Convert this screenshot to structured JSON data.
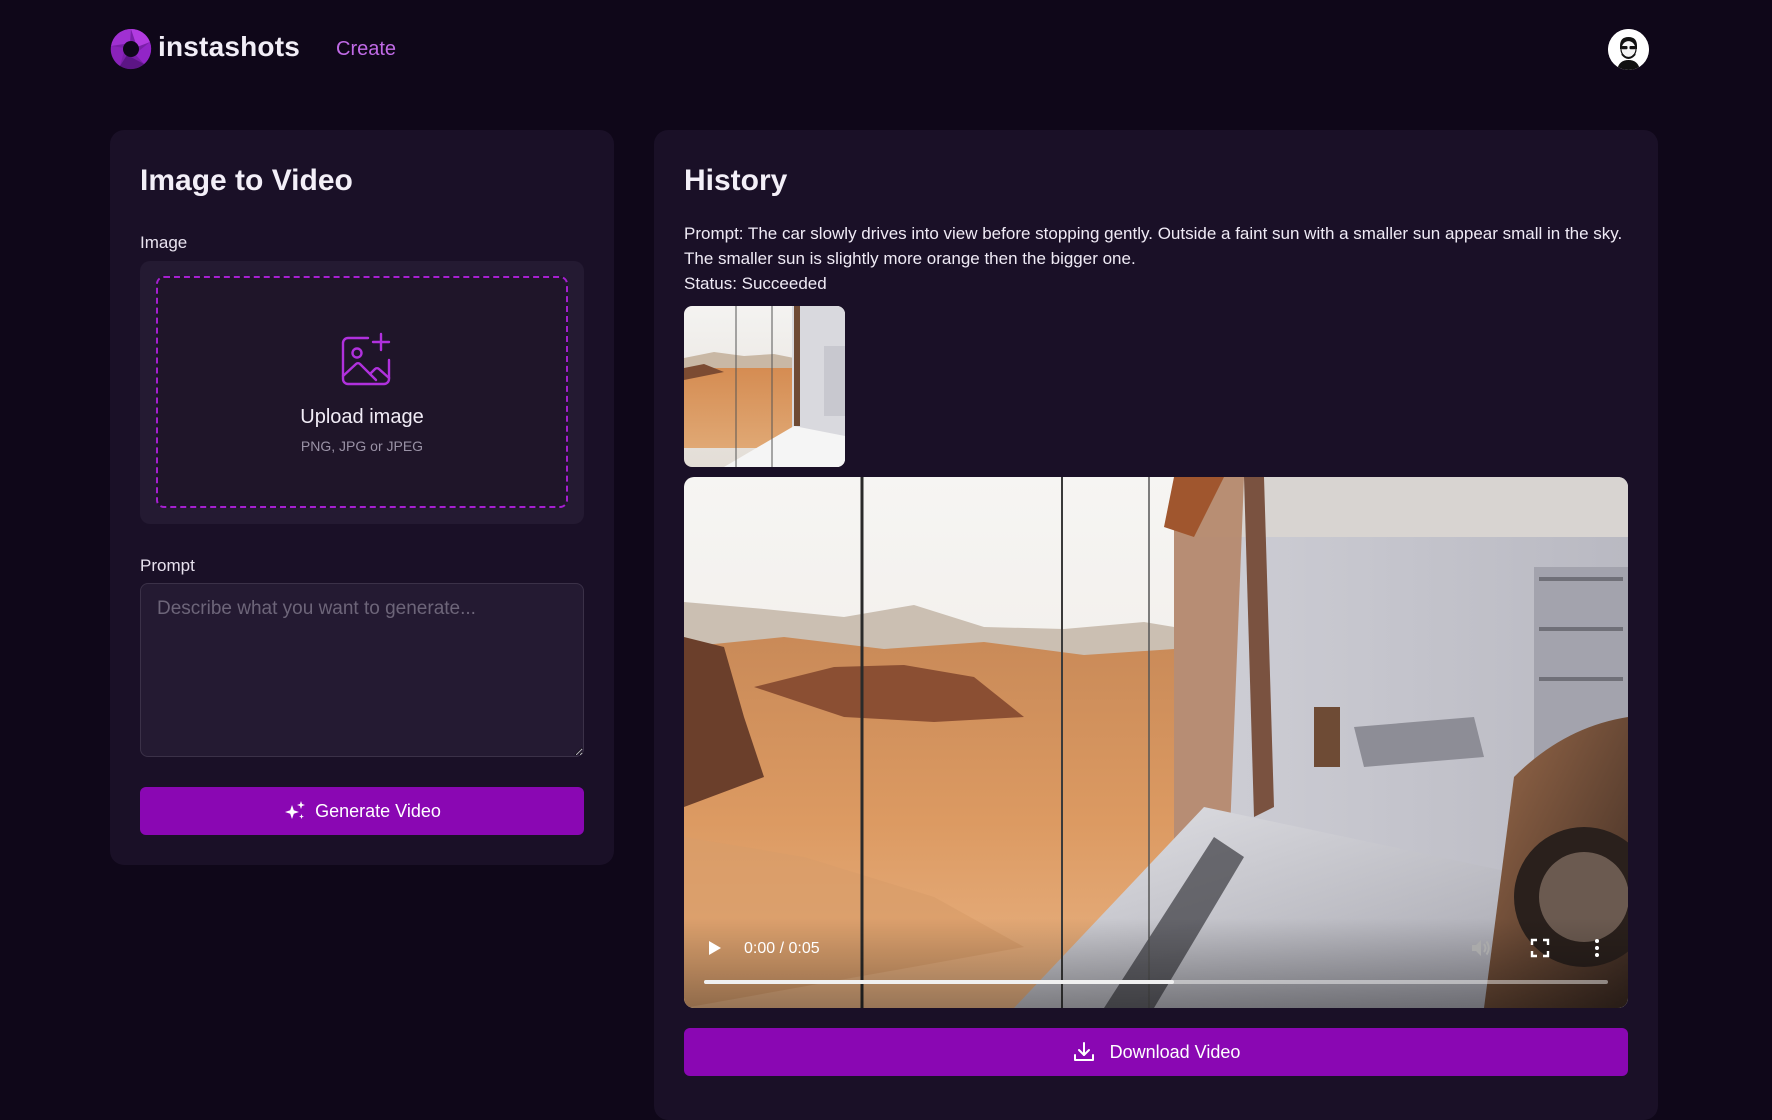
{
  "header": {
    "brand": "instashots",
    "nav_create": "Create"
  },
  "left_panel": {
    "title": "Image to Video",
    "image_label": "Image",
    "upload_title": "Upload image",
    "upload_subtitle": "PNG, JPG or JPEG",
    "prompt_label": "Prompt",
    "prompt_placeholder": "Describe what you want to generate...",
    "prompt_value": "",
    "generate_label": "Generate Video"
  },
  "right_panel": {
    "title": "History",
    "prompt_text": "Prompt: The car slowly drives into view before stopping gently. Outside a faint sun with a smaller sun appear small in the sky. The smaller sun is slightly more orange then the bigger one.",
    "status_text": "Status: Succeeded",
    "video": {
      "time": "0:00 / 0:05",
      "buffered_fraction": 0.52
    },
    "download_label": "Download Video"
  },
  "icons": {
    "logo": "aperture-icon",
    "avatar": "user-avatar-icon",
    "upload": "image-plus-icon",
    "generate": "sparkles-icon",
    "play": "play-icon",
    "volume": "volume-icon",
    "fullscreen": "fullscreen-icon",
    "more": "more-vertical-icon",
    "download": "download-icon"
  },
  "colors": {
    "background": "#0f0719",
    "panel": "#1a1027",
    "accent": "#8a07b3",
    "link": "#c06ae6",
    "dashed_border": "#a51fd0"
  }
}
